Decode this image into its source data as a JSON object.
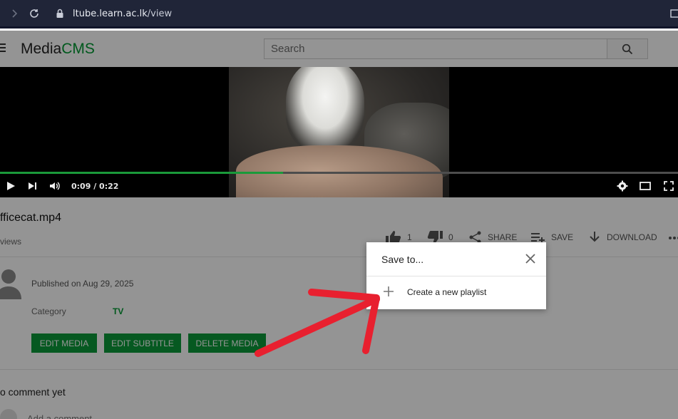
{
  "browser": {
    "url_domain": "ltube.learn.ac.lk",
    "url_path": "/view"
  },
  "header": {
    "logo_media": "Media",
    "logo_cms": "CMS",
    "search_placeholder": "Search"
  },
  "player": {
    "time": "0:09 / 0:22",
    "progress": 0.417
  },
  "video": {
    "title": "fficecat.mp4",
    "views": "views"
  },
  "actions": {
    "likes": "1",
    "dislikes": "0",
    "share": "SHARE",
    "save": "SAVE",
    "download": "DOWNLOAD"
  },
  "details": {
    "published": "Published on Aug 29, 2025",
    "category_label": "Category",
    "category_value": "TV"
  },
  "buttons": {
    "edit_media": "EDIT MEDIA",
    "edit_subtitle": "EDIT SUBTITLE",
    "delete_media": "DELETE MEDIA"
  },
  "comments": {
    "empty": "o comment yet",
    "add_placeholder": "Add a comment"
  },
  "dialog": {
    "title": "Save to...",
    "create_playlist": "Create a new playlist"
  },
  "colors": {
    "brand_green": "#009933",
    "button_green": "#0c9a3a",
    "annotation_red": "#e8202f"
  }
}
